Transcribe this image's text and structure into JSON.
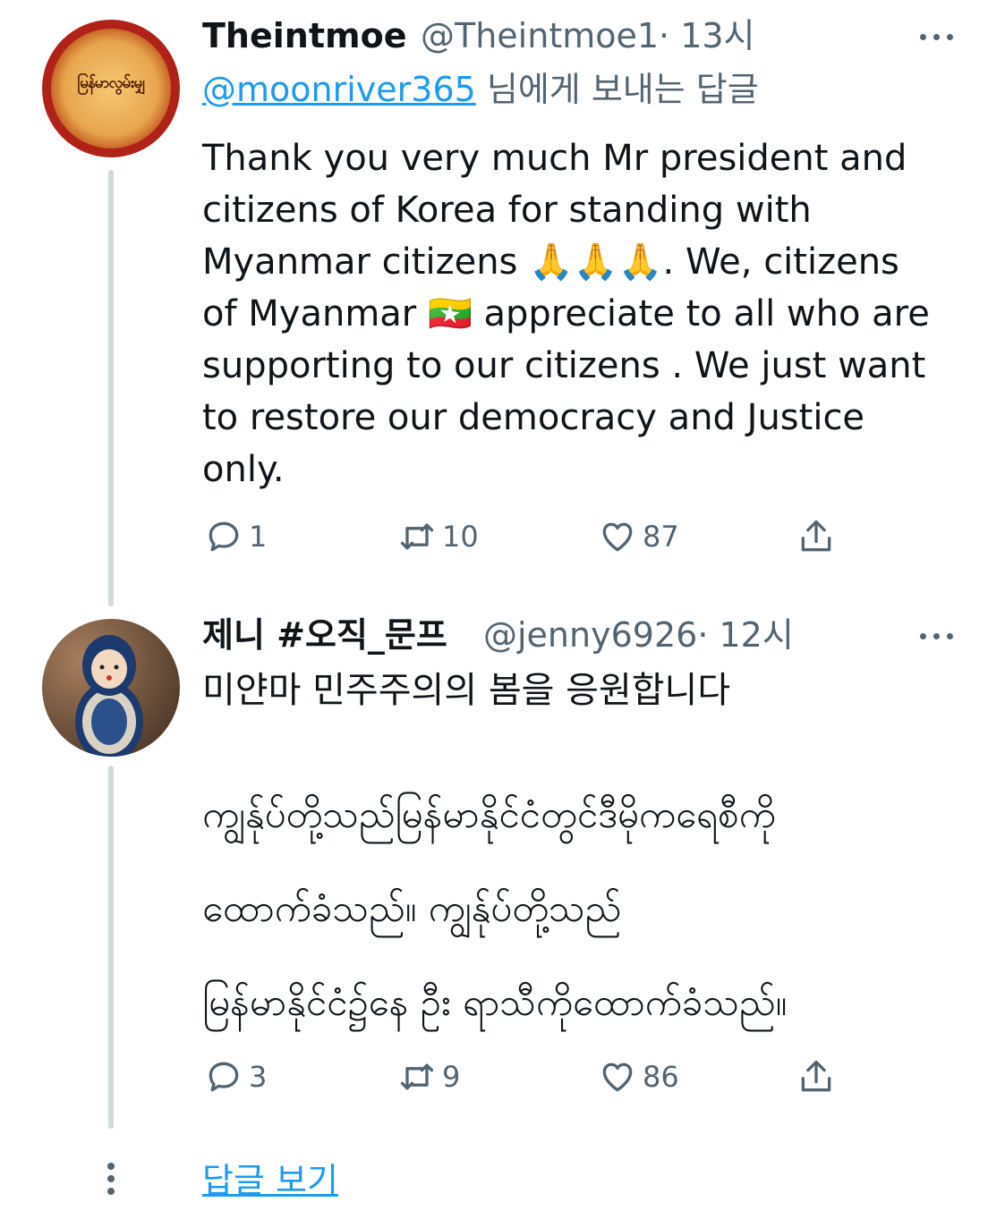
{
  "tweets": [
    {
      "name": "Theintmoe",
      "handle": "@Theintmoe1",
      "time": "· 13시",
      "reply_to_handle": "@moonriver365",
      "reply_to_suffix": " 님에게 보내는 답글",
      "avatar_text": "မြန်မာလွမ်းမျှ",
      "text_lines": [
        "Thank you very much Mr president and",
        "citizens of Korea for standing with",
        "Myanmar citizens 🙏🙏🙏. We, citizens",
        "of Myanmar 🇲🇲 appreciate to all who are",
        "supporting to our citizens . We just want",
        "to restore our democracy and Justice",
        "only."
      ],
      "replies": "1",
      "retweets": "10",
      "likes": "87"
    },
    {
      "name": "제니 #오직_문프",
      "handle": "@jenny6926",
      "time": "· 12시",
      "korean_line": "미얀마 민주주의의 봄을 응원합니다",
      "myanmar_lines": [
        "ကျွန်ုပ်တို့သည်မြန်မာနိုင်ငံတွင်ဒီမိုကရေစီကို",
        "ထောက်ခံသည်။ ကျွန်ုပ်တို့သည်",
        "မြန်မာနိုင်ငံ၌နေ ဦး ရာသီကိုထောက်ခံသည်။"
      ],
      "replies": "3",
      "retweets": "9",
      "likes": "86"
    }
  ],
  "show_replies": "답글 보기",
  "colors": {
    "text": "#0f1419",
    "secondary": "#536471",
    "link": "#1d9bf0",
    "thread": "#cfd9de"
  }
}
